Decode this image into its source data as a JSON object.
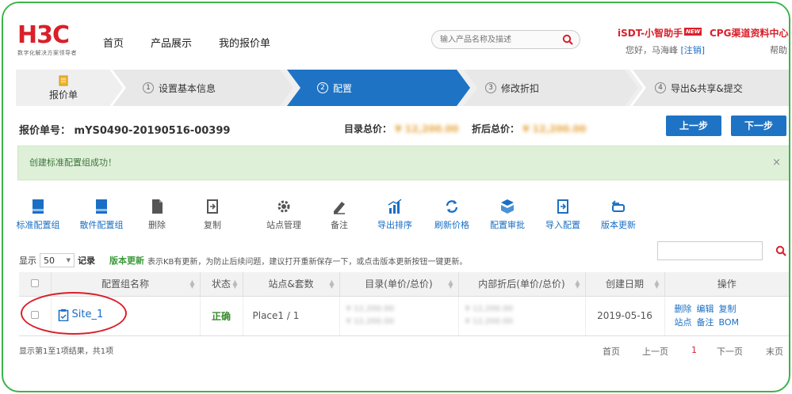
{
  "header": {
    "logo": "H3C",
    "logo_sub": "数字化解决方案领导者",
    "nav": [
      "首页",
      "产品展示",
      "我的报价单"
    ],
    "search_placeholder": "输入产品名称及描述",
    "isdt": "iSDT-小智助手",
    "new_badge": "NEW",
    "cpg": "CPG渠道资料中心",
    "greeting": "您好，马海峰",
    "logout": "[注销]",
    "help": "帮助"
  },
  "steps": {
    "first": "报价单",
    "items": [
      {
        "num": "1",
        "label": "设置基本信息"
      },
      {
        "num": "2",
        "label": "配置"
      },
      {
        "num": "3",
        "label": "修改折扣"
      },
      {
        "num": "4",
        "label": "导出&共享&提交"
      }
    ]
  },
  "quote": {
    "label": "报价单号：",
    "id": "mYS0490-20190516-00399",
    "list_total_label": "目录总价：",
    "list_total": "¥ 12,200.00",
    "discount_total_label": "折后总价：",
    "discount_total": "¥ 12,200.00"
  },
  "buttons": {
    "prev": "上一步",
    "next": "下一步"
  },
  "alert": {
    "text": "创建标准配置组成功！",
    "close": "×"
  },
  "toolbar": [
    {
      "label": "标准配置组",
      "icon": "standard-config-icon"
    },
    {
      "label": "散件配置组",
      "icon": "parts-config-icon"
    },
    {
      "label": "删除",
      "icon": "delete-icon"
    },
    {
      "label": "复制",
      "icon": "copy-icon"
    },
    {
      "label": "站点管理",
      "icon": "gear-icon"
    },
    {
      "label": "备注",
      "icon": "note-icon"
    },
    {
      "label": "导出排序",
      "icon": "bar-chart-icon"
    },
    {
      "label": "刷新价格",
      "icon": "refresh-icon"
    },
    {
      "label": "配置审批",
      "icon": "approve-icon"
    },
    {
      "label": "导入配置",
      "icon": "import-icon"
    },
    {
      "label": "版本更新",
      "icon": "version-update-icon"
    }
  ],
  "list_controls": {
    "show_label": "显示",
    "page_size": "50",
    "records_label": "记录",
    "version_note_title": "版本更新",
    "version_note": "表示KB有更新，为防止后续问题，建议打开重新保存一下，或点击版本更新按钮一键更新。"
  },
  "table": {
    "headers": [
      "配置组名称",
      "状态",
      "站点&套数",
      "目录(单价/总价)",
      "内部折后(单价/总价)",
      "创建日期",
      "操作"
    ],
    "rows": [
      {
        "name": "Site_1",
        "status": "正确",
        "site": "Place1 / 1",
        "list_unit": "¥ 12,200.00",
        "list_total": "¥ 12,200.00",
        "disc_unit": "¥ 12,200.00",
        "disc_total": "¥ 12,200.00",
        "date": "2019-05-16",
        "ops": [
          "删除",
          "编辑",
          "复制",
          "站点",
          "备注",
          "BOM"
        ]
      }
    ]
  },
  "footer": {
    "info": "显示第1至1项结果，共1项",
    "first": "首页",
    "prev": "上一页",
    "current": "1",
    "next": "下一页",
    "last": "末页"
  },
  "colors": {
    "brand_red": "#d9202a",
    "step_active": "#1f73c4",
    "link_blue": "#1a6fc4",
    "success_green": "#dff0d8"
  }
}
